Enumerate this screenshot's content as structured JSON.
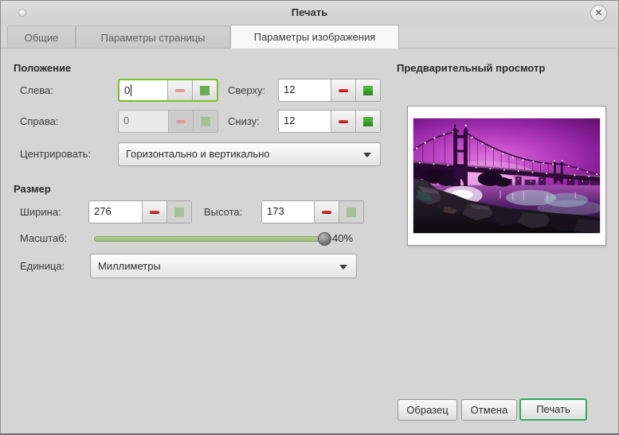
{
  "window": {
    "title": "Печать",
    "close_glyph": "✕"
  },
  "tabs": {
    "general": "Общие",
    "page": "Параметры страницы",
    "image": "Параметры изображения",
    "active_tab": "Параметры изображения"
  },
  "position": {
    "heading": "Положение",
    "left_label": "Слева:",
    "left_value": "0",
    "top_label": "Сверху:",
    "top_value": "12",
    "right_label": "Справа:",
    "right_value": "0",
    "bottom_label": "Снизу:",
    "bottom_value": "12",
    "center_label": "Центрировать:",
    "center_value": "Горизонтально и вертикально"
  },
  "size": {
    "heading": "Размер",
    "width_label": "Ширина:",
    "width_value": "276",
    "height_label": "Высота:",
    "height_value": "173",
    "scale_label": "Масштаб:",
    "scale_value": "40%",
    "scale_percent": 40,
    "unit_label": "Единица:",
    "unit_value": "Миллиметры"
  },
  "preview": {
    "heading": "Предварительный просмотр"
  },
  "actions": {
    "sample": "Образец",
    "cancel": "Отмена",
    "print": "Печать"
  },
  "icons": [
    "close-icon",
    "minus-icon",
    "plus-icon",
    "chevron-down-icon",
    "slider-knob"
  ],
  "colors": {
    "focus_green": "#79be24",
    "print_button_green": "#2eac64",
    "minus_red": "#c42222",
    "plus_green": "#3aa33a",
    "slider_track_green": "#a9c48a",
    "window_bg": "#d5d5d5"
  }
}
